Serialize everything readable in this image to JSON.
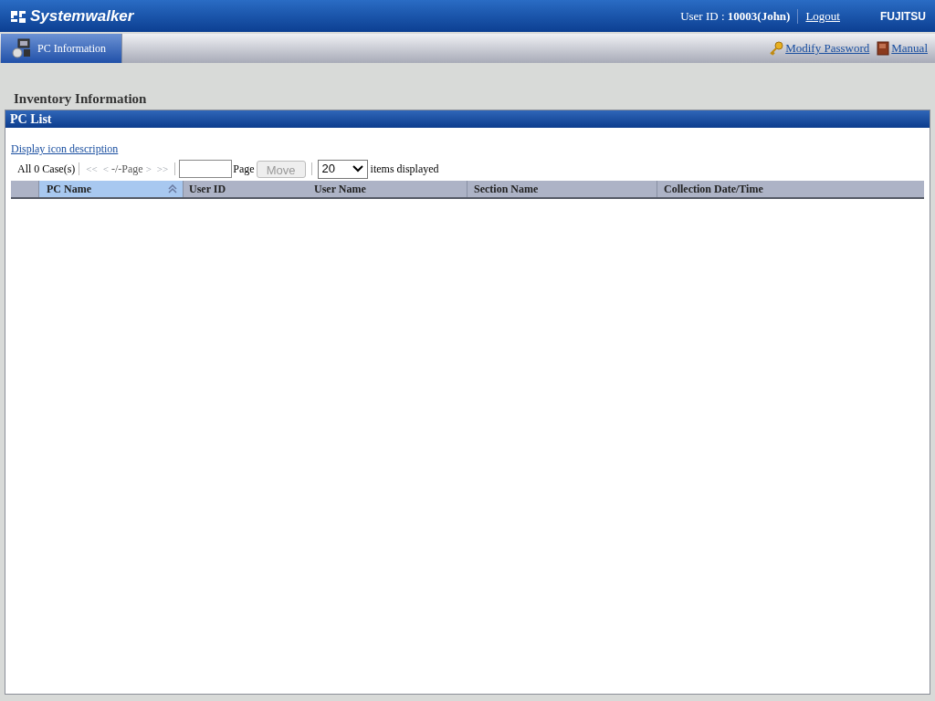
{
  "header": {
    "brand": "Systemwalker",
    "user_label": "User ID : ",
    "user_value": "10003(John)",
    "logout": "Logout",
    "vendor": "FUJITSU"
  },
  "nav": {
    "tabs": [
      {
        "label": "PC Information",
        "selected": true
      }
    ],
    "links": [
      {
        "kind": "key",
        "label": "Modify Password"
      },
      {
        "kind": "book",
        "label": "Manual"
      }
    ]
  },
  "page_title": "Inventory Information",
  "panel_title": "PC List",
  "icon_description_link": "Display icon description",
  "pager": {
    "count": "All 0 Case(s)",
    "first": "<<",
    "prev": "<",
    "page_info": "-/-Page",
    "next": ">",
    "last": ">>",
    "nav_disabled": true,
    "page_label": "Page",
    "move": "Move",
    "move_disabled": true,
    "per_page": "20",
    "per_page_label": "items displayed"
  },
  "table": {
    "columns": [
      {
        "label": "PC Name",
        "selected": true
      },
      {
        "label": "User ID",
        "selected": false
      },
      {
        "label": "User Name",
        "selected": false
      },
      {
        "label": "Section Name",
        "selected": false
      },
      {
        "label": "Collection Date/Time",
        "selected": false
      }
    ]
  }
}
